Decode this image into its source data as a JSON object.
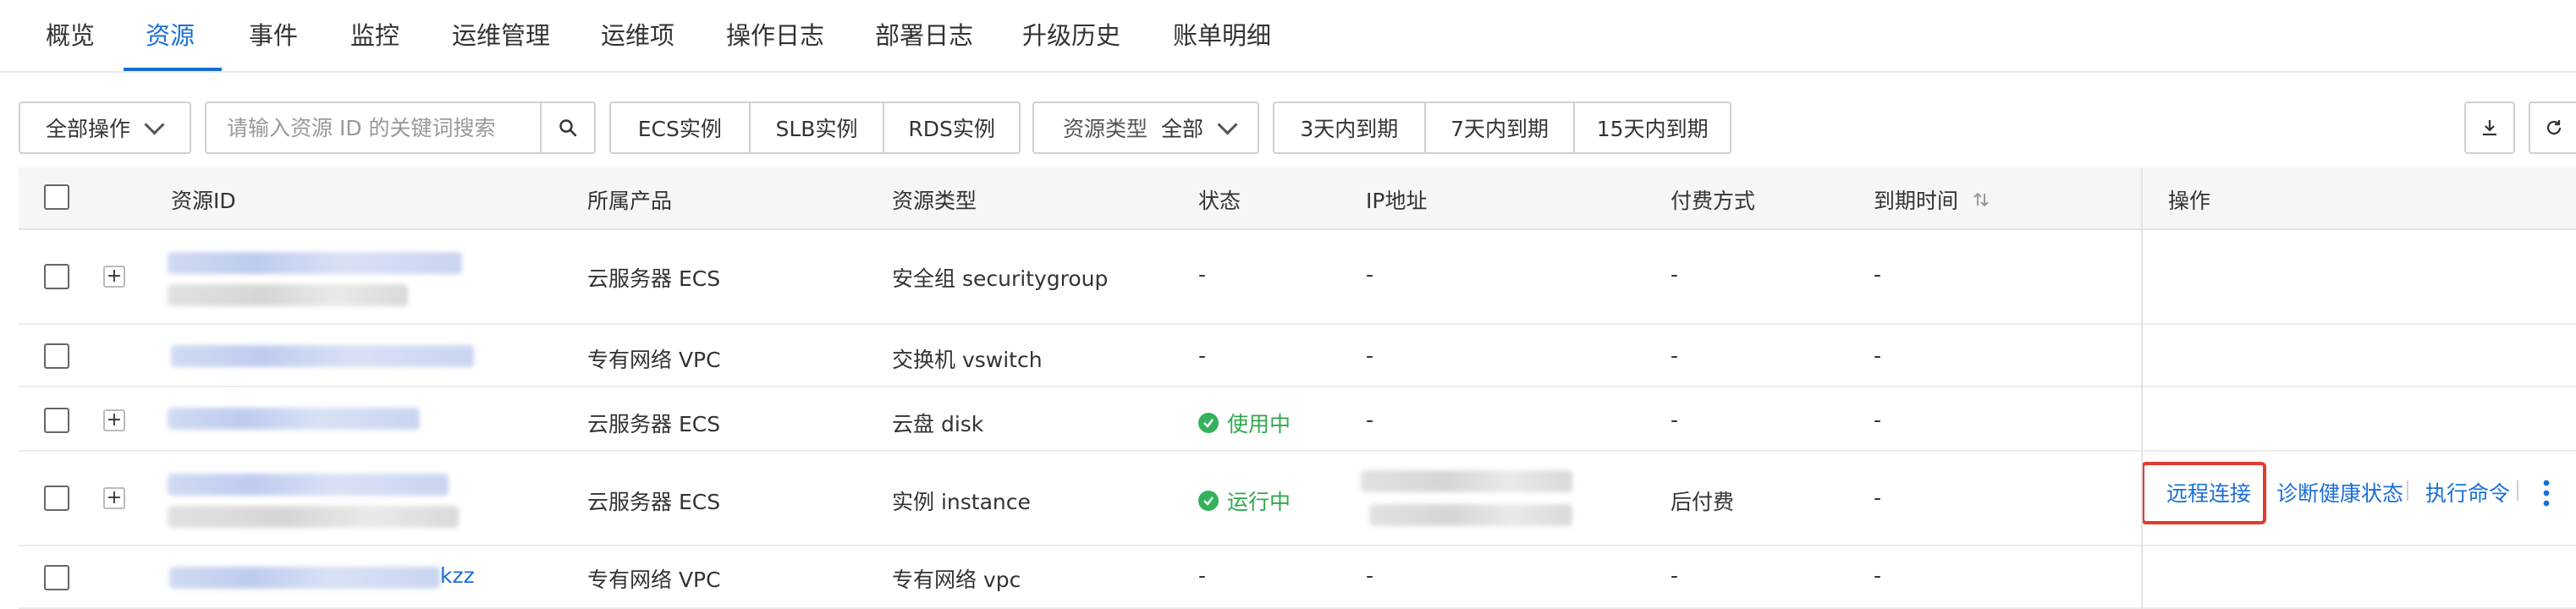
{
  "tabs": [
    "概览",
    "资源",
    "事件",
    "监控",
    "运维管理",
    "运维项",
    "操作日志",
    "部署日志",
    "升级历史",
    "账单明细"
  ],
  "active_tab": "资源",
  "toolbar": {
    "all_ops": "全部操作",
    "search_placeholder": "请输入资源 ID 的关键词搜索",
    "type_buttons": [
      "ECS实例",
      "SLB实例",
      "RDS实例"
    ],
    "resource_type_label": "资源类型",
    "resource_type_value": "全部",
    "expiry_buttons": [
      "3天内到期",
      "7天内到期",
      "15天内到期"
    ]
  },
  "table": {
    "columns": {
      "resource_id": "资源ID",
      "product": "所属产品",
      "type": "资源类型",
      "status": "状态",
      "ip": "IP地址",
      "billing": "付费方式",
      "expiry": "到期时间",
      "ops": "操作"
    },
    "rows": [
      {
        "product": "云服务器 ECS",
        "type": "安全组 securitygroup",
        "status": "-",
        "ip": "-",
        "billing": "-",
        "expiry": "-"
      },
      {
        "product": "专有网络 VPC",
        "type": "交换机 vswitch",
        "status": "-",
        "ip": "-",
        "billing": "-",
        "expiry": "-"
      },
      {
        "product": "云服务器 ECS",
        "type": "云盘 disk",
        "status": "使用中",
        "ip": "-",
        "billing": "-",
        "expiry": "-"
      },
      {
        "product": "云服务器 ECS",
        "type": "实例 instance",
        "status": "运行中",
        "ip": "",
        "billing": "后付费",
        "expiry": "-"
      },
      {
        "id_suffix": "kzz",
        "product": "专有网络 VPC",
        "type": "专有网络 vpc",
        "status": "-",
        "ip": "-",
        "billing": "-",
        "expiry": "-"
      }
    ],
    "row_actions": [
      "远程连接",
      "诊断健康状态",
      "执行命令"
    ],
    "expander_symbol": "+"
  },
  "colors": {
    "accent": "#1a6fd6",
    "status_green": "#2fa84f",
    "highlight_red": "#e23b2e"
  }
}
